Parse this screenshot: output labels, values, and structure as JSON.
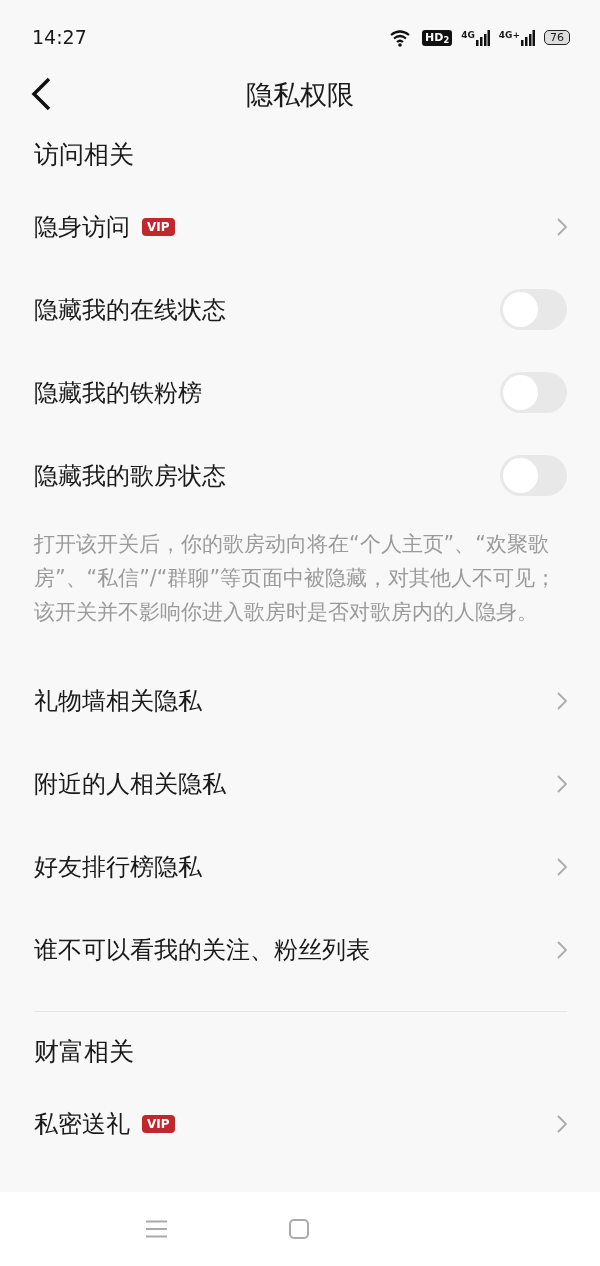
{
  "status_bar": {
    "time": "14:27",
    "hd": "HD$_{2}$",
    "signals": [
      "4G",
      "4G+"
    ],
    "battery": "76"
  },
  "header": {
    "title": "隐私权限"
  },
  "sections": [
    {
      "title": "访问相关",
      "items": [
        {
          "kind": "link",
          "label": "隐身访问",
          "badge": "VIP"
        },
        {
          "kind": "toggle",
          "label": "隐藏我的在线状态",
          "on": false
        },
        {
          "kind": "toggle",
          "label": "隐藏我的铁粉榜",
          "on": false
        },
        {
          "kind": "toggle",
          "label": "隐藏我的歌房状态",
          "on": false
        },
        {
          "kind": "note",
          "label": "打开该开关后，你的歌房动向将在“个人主页”、“欢聚歌房”、“私信”/“群聊”等页面中被隐藏，对其他人不可见；该开关并不影响你进入歌房时是否对歌房内的人隐身。"
        },
        {
          "kind": "link",
          "label": "礼物墙相关隐私"
        },
        {
          "kind": "link",
          "label": "附近的人相关隐私"
        },
        {
          "kind": "link",
          "label": "好友排行榜隐私"
        },
        {
          "kind": "link",
          "label": "谁不可以看我的关注、粉丝列表"
        }
      ]
    },
    {
      "title": "财富相关",
      "items": [
        {
          "kind": "link",
          "label": "私密送礼",
          "badge": "VIP"
        }
      ]
    }
  ]
}
